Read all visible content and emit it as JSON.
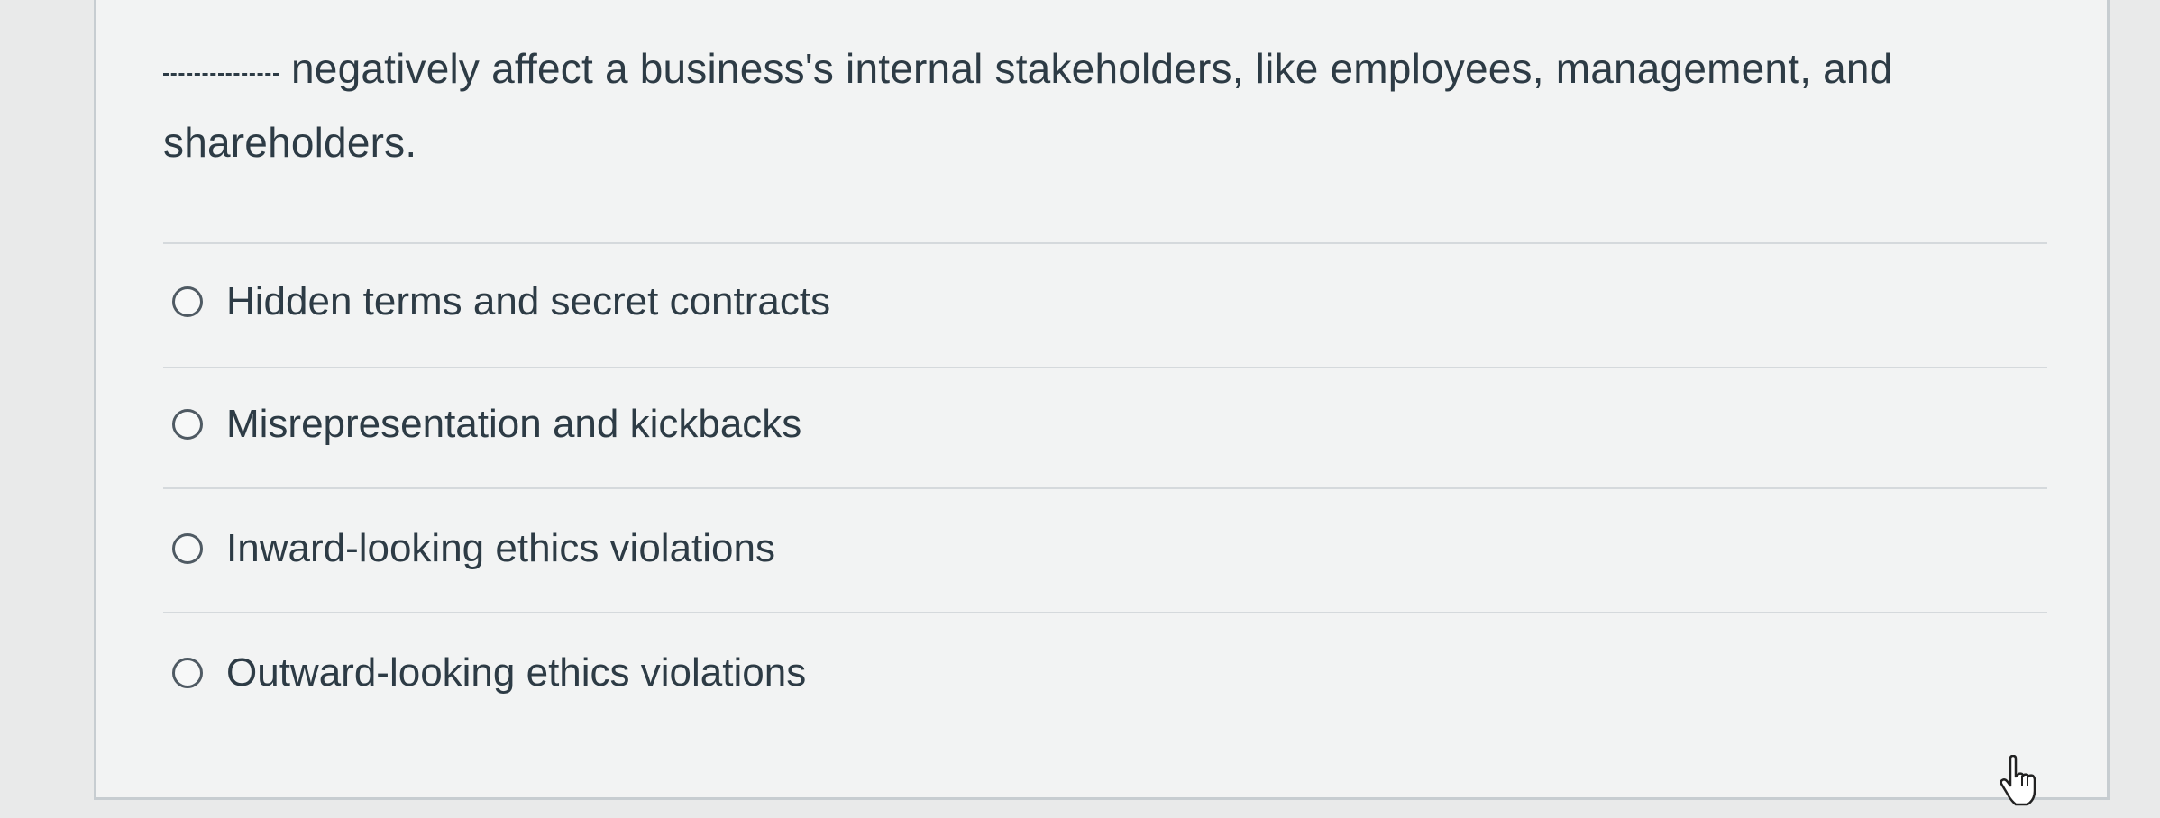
{
  "question": {
    "blank": "_____",
    "text": "negatively affect a business's internal stakeholders, like employees, management, and shareholders."
  },
  "answers": [
    {
      "label": "Hidden terms and secret contracts",
      "selected": false
    },
    {
      "label": "Misrepresentation and kickbacks",
      "selected": false
    },
    {
      "label": "Inward-looking ethics violations",
      "selected": false
    },
    {
      "label": "Outward-looking ethics violations",
      "selected": false
    }
  ],
  "icons": {
    "radio": "radio-button-empty-icon",
    "pointer": "hand-pointer-cursor-icon"
  }
}
